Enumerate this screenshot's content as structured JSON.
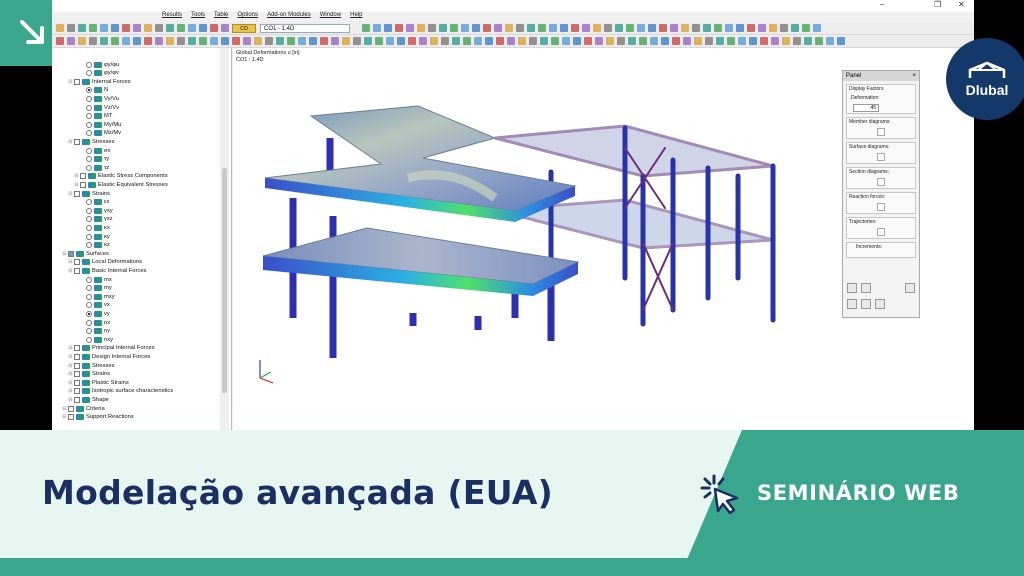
{
  "app": {
    "menu": [
      "Results",
      "Tools",
      "Table",
      "Options",
      "Add-on Modules",
      "Window",
      "Help"
    ],
    "load_case": "CO1 - 1.4D",
    "load_case_tag": "CO"
  },
  "viewport": {
    "title_line1": "Global Deformations u [in]",
    "title_line2": "CO1 : 1.4D"
  },
  "navigator": {
    "rows": [
      {
        "indent": 4,
        "type": "radio",
        "label": "φy/φu"
      },
      {
        "indent": 4,
        "type": "radio",
        "label": "φy/φv"
      },
      {
        "indent": 2,
        "type": "check",
        "label": "Internal Forces"
      },
      {
        "indent": 4,
        "type": "radio",
        "on": true,
        "label": "N"
      },
      {
        "indent": 4,
        "type": "radio",
        "label": "Vy/Vu"
      },
      {
        "indent": 4,
        "type": "radio",
        "label": "Vz/Vv"
      },
      {
        "indent": 4,
        "type": "radio",
        "label": "MT"
      },
      {
        "indent": 4,
        "type": "radio",
        "label": "My/Mu"
      },
      {
        "indent": 4,
        "type": "radio",
        "label": "Mz/Mv"
      },
      {
        "indent": 2,
        "type": "check",
        "label": "Stresses"
      },
      {
        "indent": 4,
        "type": "radio",
        "label": "σx"
      },
      {
        "indent": 4,
        "type": "radio",
        "label": "τy"
      },
      {
        "indent": 4,
        "type": "radio",
        "label": "τz"
      },
      {
        "indent": 3,
        "type": "check",
        "label": "Elastic Stress Components"
      },
      {
        "indent": 3,
        "type": "check",
        "label": "Elastic Equivalent Stresses"
      },
      {
        "indent": 2,
        "type": "check",
        "label": "Strains"
      },
      {
        "indent": 4,
        "type": "radio",
        "label": "εx"
      },
      {
        "indent": 4,
        "type": "radio",
        "label": "γxy"
      },
      {
        "indent": 4,
        "type": "radio",
        "label": "γxz"
      },
      {
        "indent": 4,
        "type": "radio",
        "label": "κx"
      },
      {
        "indent": 4,
        "type": "radio",
        "label": "κy"
      },
      {
        "indent": 4,
        "type": "radio",
        "label": "κz"
      },
      {
        "indent": 1,
        "type": "check",
        "on": true,
        "label": "Surfaces"
      },
      {
        "indent": 2,
        "type": "check",
        "label": "Local Deformations"
      },
      {
        "indent": 2,
        "type": "check",
        "label": "Basic Internal Forces"
      },
      {
        "indent": 4,
        "type": "radio",
        "label": "mx"
      },
      {
        "indent": 4,
        "type": "radio",
        "label": "my"
      },
      {
        "indent": 4,
        "type": "radio",
        "label": "mxy"
      },
      {
        "indent": 4,
        "type": "radio",
        "label": "vx"
      },
      {
        "indent": 4,
        "type": "radio",
        "on": true,
        "label": "vy"
      },
      {
        "indent": 4,
        "type": "radio",
        "label": "nx"
      },
      {
        "indent": 4,
        "type": "radio",
        "label": "ny"
      },
      {
        "indent": 4,
        "type": "radio",
        "label": "nxy"
      },
      {
        "indent": 2,
        "type": "check",
        "label": "Principal Internal Forces"
      },
      {
        "indent": 2,
        "type": "check",
        "label": "Design Internal Forces"
      },
      {
        "indent": 2,
        "type": "check",
        "label": "Stresses"
      },
      {
        "indent": 2,
        "type": "check",
        "label": "Strains"
      },
      {
        "indent": 2,
        "type": "check",
        "label": "Plastic Strains"
      },
      {
        "indent": 2,
        "type": "check",
        "label": "Isotropic surface characteristics"
      },
      {
        "indent": 2,
        "type": "check",
        "label": "Shape"
      },
      {
        "indent": 1,
        "type": "check",
        "label": "Criteria"
      },
      {
        "indent": 1,
        "type": "check",
        "label": "Support Reactions"
      }
    ]
  },
  "panel": {
    "title": "Panel",
    "close": "×",
    "group_factors": "Display Factors",
    "deformation_label": "Deformation:",
    "deformation_value": "45",
    "member_diagrams": "Member diagrams:",
    "surface_diagrams": "Surface diagrams:",
    "section_diagrams": "Section diagrams:",
    "reaction_forces": "Reaction forces:",
    "trajectories": "Trajectories:",
    "increments": "Increments:"
  },
  "logo": {
    "text": "Dlubal"
  },
  "banner": {
    "title": "Modelação avançada (EUA)",
    "label": "SEMINÁRIO WEB"
  },
  "colors": {
    "brand_green": "#3aa68d",
    "brand_navy": "#1b2f63",
    "logo_bg": "#15386b",
    "banner_bg": "#e8f6f2"
  }
}
